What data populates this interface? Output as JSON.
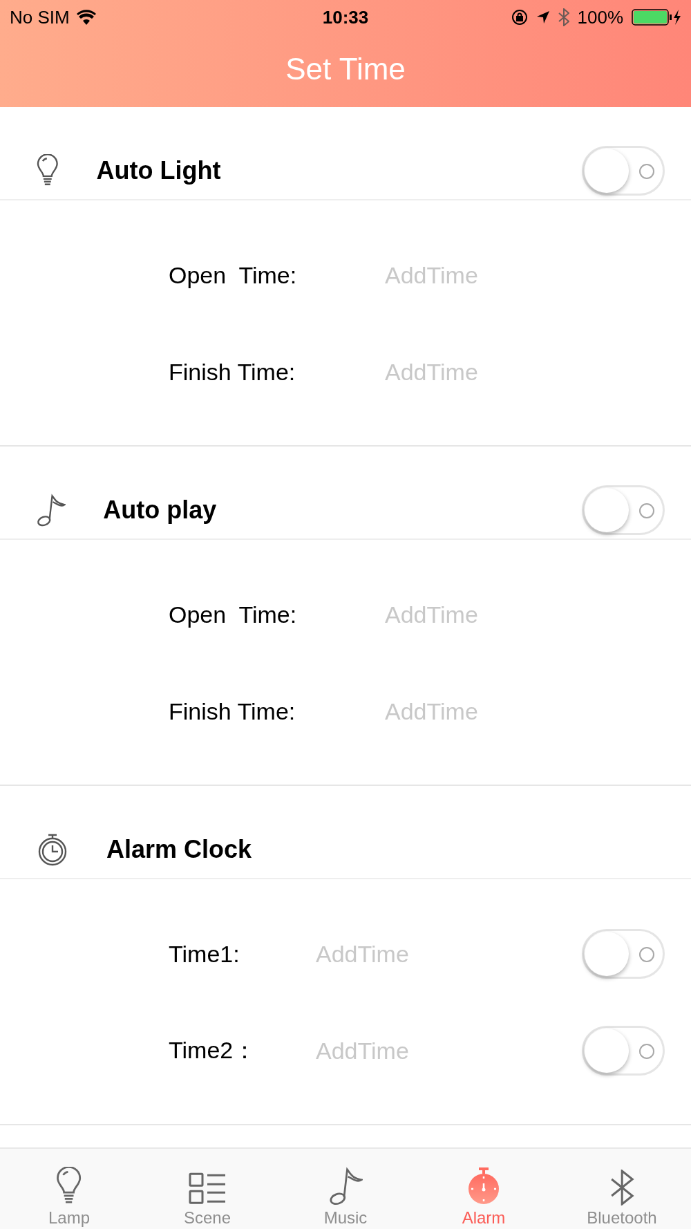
{
  "status_bar": {
    "carrier": "No SIM",
    "time": "10:33",
    "battery": "100%"
  },
  "title": "Set Time",
  "sections": [
    {
      "title": "Auto Light",
      "on": false,
      "rows": [
        {
          "label": "Open  Time:",
          "placeholder": "AddTime"
        },
        {
          "label": "Finish Time:",
          "placeholder": "AddTime"
        }
      ]
    },
    {
      "title": "Auto play",
      "on": false,
      "rows": [
        {
          "label": "Open  Time:",
          "placeholder": "AddTime"
        },
        {
          "label": "Finish Time:",
          "placeholder": "AddTime"
        }
      ]
    },
    {
      "title": "Alarm Clock",
      "rows": [
        {
          "label": "Time1:",
          "placeholder": "AddTime",
          "on": false
        },
        {
          "label": "Time2：",
          "placeholder": "AddTime",
          "on": false
        }
      ]
    }
  ],
  "tabs": [
    {
      "label": "Lamp",
      "selected": false
    },
    {
      "label": "Scene",
      "selected": false
    },
    {
      "label": "Music",
      "selected": false
    },
    {
      "label": "Alarm",
      "selected": true
    },
    {
      "label": "Bluetooth",
      "selected": false
    }
  ]
}
